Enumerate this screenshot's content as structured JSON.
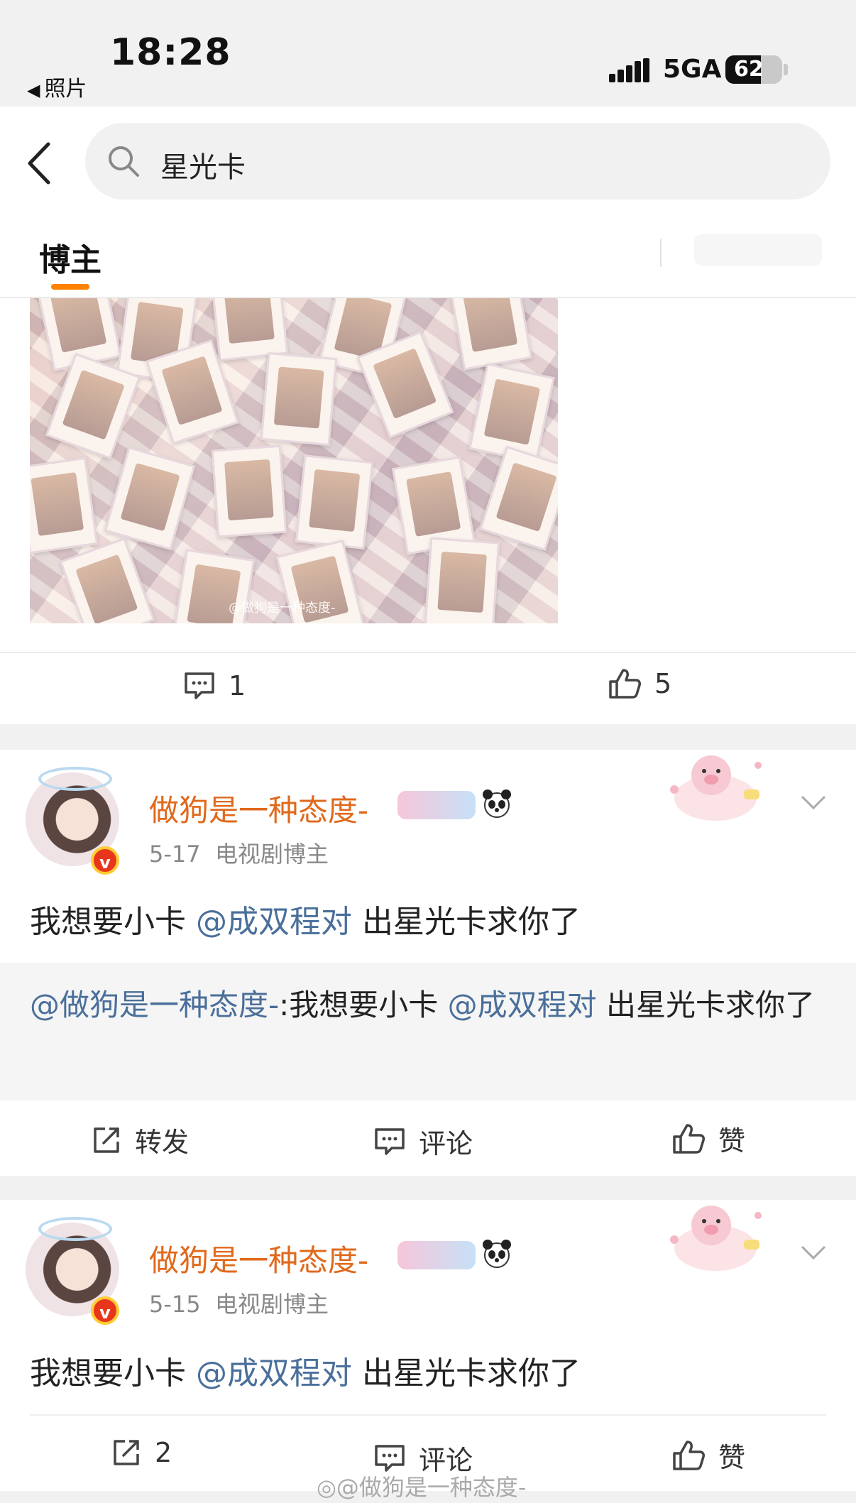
{
  "status_bar": {
    "time": "18:28",
    "back_app": "照片",
    "network": "5GA",
    "battery": "62",
    "battery_level": 0.62
  },
  "search": {
    "query": "星光卡"
  },
  "tabs": {
    "active": "博主"
  },
  "post1": {
    "image_watermark": "@做狗是一种态度-",
    "comments": "1",
    "likes": "5"
  },
  "post2": {
    "author": "做狗是一种态度-",
    "date": "5-17",
    "role": "电视剧博主",
    "text_pre": "我想要小卡 ",
    "mention": "@成双程对",
    "text_post": " 出星光卡求你了",
    "quote_author": "@做狗是一种态度-",
    "quote_pre": ":我想要小卡 ",
    "quote_mention": "@成双程对",
    "quote_post": " 出星光卡求你了",
    "repost_label": "转发",
    "comment_label": "评论",
    "like_label": "赞"
  },
  "post3": {
    "author": "做狗是一种态度-",
    "date": "5-15",
    "role": "电视剧博主",
    "text_pre": "我想要小卡 ",
    "mention": "@成双程对",
    "text_post": " 出星光卡求你了",
    "repost_count": "2",
    "comment_label": "评论",
    "like_label": "赞"
  },
  "bottom_watermark": "@做狗是一种态度-",
  "colors": {
    "accent": "#ff8200",
    "name": "#e0691c",
    "mention": "#4a6f9a"
  }
}
